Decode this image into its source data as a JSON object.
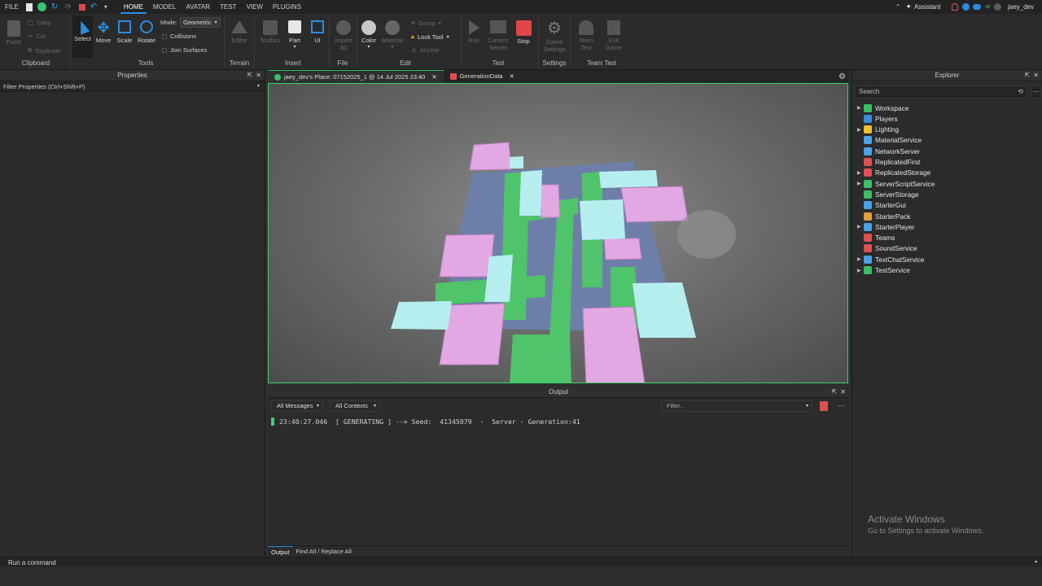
{
  "titlebar": {
    "menus": [
      "FILE",
      "HOME",
      "MODEL",
      "AVATAR",
      "TEST",
      "VIEW",
      "PLUGINS"
    ],
    "active_menu": "HOME",
    "assistant": "Assistant",
    "user": "jaey_dev"
  },
  "ribbon": {
    "clipboard": {
      "paste": "Paste",
      "copy": "Copy",
      "cut": "Cut",
      "duplicate": "Duplicate",
      "group": "Clipboard"
    },
    "tools": {
      "select": "Select",
      "move": "Move",
      "scale": "Scale",
      "rotate": "Rotate",
      "mode_label": "Mode:",
      "mode_value": "Geometric",
      "collisions": "Collisions",
      "join_surfaces": "Join Surfaces",
      "group": "Tools"
    },
    "terrain": {
      "editor": "Editor",
      "group": "Terrain"
    },
    "insert": {
      "toolbox": "Toolbox",
      "part": "Part",
      "ui": "UI",
      "group": "Insert"
    },
    "file": {
      "import3d_1": "Import",
      "import3d_2": "3D",
      "group": "File"
    },
    "edit": {
      "color": "Color",
      "material": "Material",
      "group_btn": "Group",
      "lock_tool": "Lock Tool",
      "anchor": "Anchor",
      "group": "Edit"
    },
    "test": {
      "run": "Run",
      "current_1": "Current:",
      "current_2": "Server",
      "stop": "Stop",
      "group": "Test"
    },
    "settings": {
      "game_1": "Game",
      "game_2": "Settings",
      "group": "Settings"
    },
    "team_test": {
      "team_1": "Team",
      "team_2": "Test",
      "exit_1": "Exit",
      "exit_2": "Game",
      "group": "Team Test"
    }
  },
  "properties": {
    "title": "Properties",
    "filter": "Filter Properties (Ctrl+Shift+P)"
  },
  "doc_tabs": [
    {
      "label": "jaey_dev's Place: 07152025_1 @ 14 Jul 2025 23:40"
    },
    {
      "label": "GenerationData"
    }
  ],
  "output": {
    "title": "Output",
    "messages_filter": "All Messages",
    "contexts_filter": "All Contexts",
    "filter_placeholder": "Filter...",
    "line": "23:40:27.046  [ GENERATING ] --> Seed:  41345079  -  Server - Generation:41",
    "tabs": [
      "Output",
      "Find All / Replace All"
    ]
  },
  "explorer": {
    "title": "Explorer",
    "search_placeholder": "Search",
    "items": [
      {
        "label": "Workspace",
        "color": "#3bbf66",
        "expandable": true
      },
      {
        "label": "Players",
        "color": "#3b8de0",
        "expandable": false
      },
      {
        "label": "Lighting",
        "color": "#f0c030",
        "expandable": true
      },
      {
        "label": "MaterialService",
        "color": "#4aa3e8",
        "expandable": false
      },
      {
        "label": "NetworkServer",
        "color": "#4aa3e8",
        "expandable": false
      },
      {
        "label": "ReplicatedFirst",
        "color": "#e05050",
        "expandable": false
      },
      {
        "label": "ReplicatedStorage",
        "color": "#e05050",
        "expandable": true
      },
      {
        "label": "ServerScriptService",
        "color": "#3bbf66",
        "expandable": true
      },
      {
        "label": "ServerStorage",
        "color": "#3bbf66",
        "expandable": false
      },
      {
        "label": "StarterGui",
        "color": "#4aa3e8",
        "expandable": false
      },
      {
        "label": "StarterPack",
        "color": "#e0a040",
        "expandable": false
      },
      {
        "label": "StarterPlayer",
        "color": "#4aa3e8",
        "expandable": true
      },
      {
        "label": "Teams",
        "color": "#e05050",
        "expandable": false
      },
      {
        "label": "SoundService",
        "color": "#e05050",
        "expandable": false
      },
      {
        "label": "TextChatService",
        "color": "#4aa3e8",
        "expandable": true
      },
      {
        "label": "TestService",
        "color": "#3bbf66",
        "expandable": true
      }
    ]
  },
  "command_bar": {
    "placeholder": "Run a command"
  },
  "watermark": {
    "line1": "Activate Windows",
    "line2": "Go to Settings to activate Windows."
  }
}
